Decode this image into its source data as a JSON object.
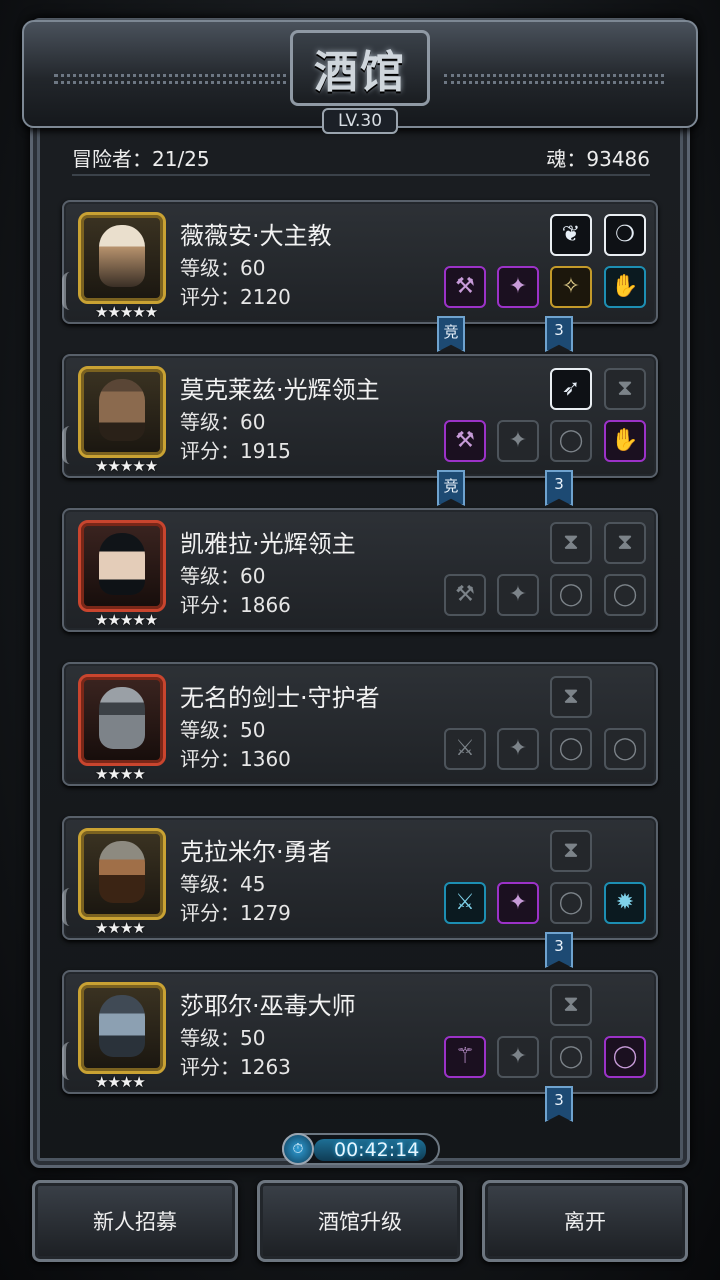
{
  "header": {
    "title": "酒馆",
    "level": "LV.30"
  },
  "stats": {
    "adventurers": "冒险者：21/25",
    "souls": "魂：93486"
  },
  "heroes": [
    {
      "name": "薇薇安·大主教",
      "level": "等级：60",
      "score": "评分：2120",
      "stars": "★★★★★",
      "frame": "gold",
      "top_slots": [
        {
          "style": "white",
          "icon": "wing-icon",
          "g": "❦"
        },
        {
          "style": "white",
          "icon": "necklace-icon",
          "g": "❍"
        }
      ],
      "bottom_slots": [
        {
          "style": "purple",
          "icon": "hammer-icon",
          "g": "⚒"
        },
        {
          "style": "purple",
          "icon": "armor-icon",
          "g": "✦"
        },
        {
          "style": "gold",
          "icon": "amulet-icon",
          "g": "✧"
        },
        {
          "style": "cyan",
          "icon": "gauntlet-icon",
          "g": "✋"
        }
      ],
      "tags": [
        "竞",
        "3"
      ]
    },
    {
      "name": "莫克莱兹·光辉领主",
      "level": "等级：60",
      "score": "评分：1915",
      "stars": "★★★★★",
      "frame": "gold",
      "top_slots": [
        {
          "style": "white",
          "icon": "feather-icon",
          "g": "➶"
        },
        {
          "style": "empty",
          "icon": "empty-slot-icon",
          "g": "⧗"
        }
      ],
      "bottom_slots": [
        {
          "style": "purple",
          "icon": "mace-icon",
          "g": "⚒"
        },
        {
          "style": "empty",
          "icon": "armor-slot-icon",
          "g": "✦"
        },
        {
          "style": "empty",
          "icon": "ring-slot-icon",
          "g": "◯"
        },
        {
          "style": "purple",
          "icon": "bracer-icon",
          "g": "✋"
        }
      ],
      "tags": [
        "竞",
        "3"
      ]
    },
    {
      "name": "凯雅拉·光辉领主",
      "level": "等级：60",
      "score": "评分：1866",
      "stars": "★★★★★",
      "frame": "red",
      "top_slots": [
        {
          "style": "empty",
          "icon": "empty-slot-icon",
          "g": "⧗"
        },
        {
          "style": "empty",
          "icon": "empty-slot-icon",
          "g": "⧗"
        }
      ],
      "bottom_slots": [
        {
          "style": "empty",
          "icon": "hammer-slot-icon",
          "g": "⚒"
        },
        {
          "style": "empty",
          "icon": "armor-slot-icon",
          "g": "✦"
        },
        {
          "style": "empty",
          "icon": "ring-slot-icon",
          "g": "◯"
        },
        {
          "style": "empty",
          "icon": "ring-slot-icon",
          "g": "◯"
        }
      ],
      "tags": []
    },
    {
      "name": "无名的剑士·守护者",
      "level": "等级：50",
      "score": "评分：1360",
      "stars": "★★★★",
      "frame": "red",
      "top_slots": [
        {
          "style": "empty",
          "icon": "empty-slot-icon",
          "g": "⧗"
        }
      ],
      "bottom_slots": [
        {
          "style": "empty",
          "icon": "sword-slot-icon",
          "g": "⚔"
        },
        {
          "style": "empty",
          "icon": "armor-slot-icon",
          "g": "✦"
        },
        {
          "style": "empty",
          "icon": "ring-slot-icon",
          "g": "◯"
        },
        {
          "style": "empty",
          "icon": "ring-slot-icon",
          "g": "◯"
        }
      ],
      "tags": []
    },
    {
      "name": "克拉米尔·勇者",
      "level": "等级：45",
      "score": "评分：1279",
      "stars": "★★★★",
      "frame": "gold",
      "top_slots": [
        {
          "style": "empty",
          "icon": "empty-slot-icon",
          "g": "⧗"
        }
      ],
      "bottom_slots": [
        {
          "style": "cyan",
          "icon": "axe-icon",
          "g": "⚔"
        },
        {
          "style": "purple",
          "icon": "leather-armor-icon",
          "g": "✦"
        },
        {
          "style": "empty",
          "icon": "ring-slot-icon",
          "g": "◯"
        },
        {
          "style": "cyan",
          "icon": "gem-icon",
          "g": "✹"
        }
      ],
      "tags": [
        "3"
      ]
    },
    {
      "name": "莎耶尔·巫毒大师",
      "level": "等级：50",
      "score": "评分：1263",
      "stars": "★★★★",
      "frame": "gold",
      "top_slots": [
        {
          "style": "empty",
          "icon": "empty-slot-icon",
          "g": "⧗"
        }
      ],
      "bottom_slots": [
        {
          "style": "purple",
          "icon": "staff-icon",
          "g": "⚚"
        },
        {
          "style": "empty",
          "icon": "armor-slot-icon",
          "g": "✦"
        },
        {
          "style": "empty",
          "icon": "ring-slot-icon",
          "g": "◯"
        },
        {
          "style": "purple",
          "icon": "ring-icon",
          "g": "◯"
        }
      ],
      "tags": [
        "3"
      ]
    }
  ],
  "timer": "00:42:14",
  "buttons": {
    "recruit": "新人招募",
    "upgrade": "酒馆升级",
    "leave": "离开"
  },
  "colors": {
    "rare_purple": "#9c32c8",
    "epic_gold": "#c39a2a",
    "set_cyan": "#1d8fb3",
    "tag_blue": "#1d4a73"
  }
}
